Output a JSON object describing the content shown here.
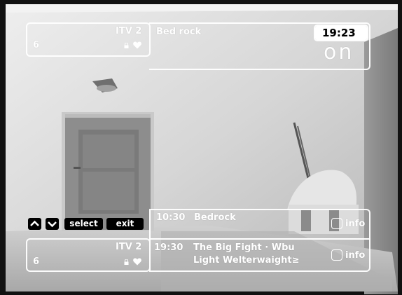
{
  "top_banner": {
    "channel_name": "ITV 2",
    "channel_number": "6",
    "programme_title": "Bed rock",
    "clock": "19:23",
    "status_logo": "on",
    "lock_icon": "lock-icon",
    "favourite_icon": "heart-icon"
  },
  "nav_controls": {
    "up_icon": "chevron-up-icon",
    "down_icon": "chevron-down-icon",
    "select_label": "select",
    "exit_label": "exit"
  },
  "bottom_banner": {
    "channel_name": "ITV 2",
    "channel_number": "6",
    "now": {
      "time": "10:30",
      "title": "Bedrock",
      "info_label": "info"
    },
    "next": {
      "time": "19:30",
      "title": "The Big Fight · Wbu",
      "title_line2": "Light Welterwaight≥",
      "info_label": "info"
    }
  },
  "colors": {
    "overlay_border": "#ffffff",
    "button_fill": "#000000",
    "photo_tone": "#d8d8d8"
  }
}
